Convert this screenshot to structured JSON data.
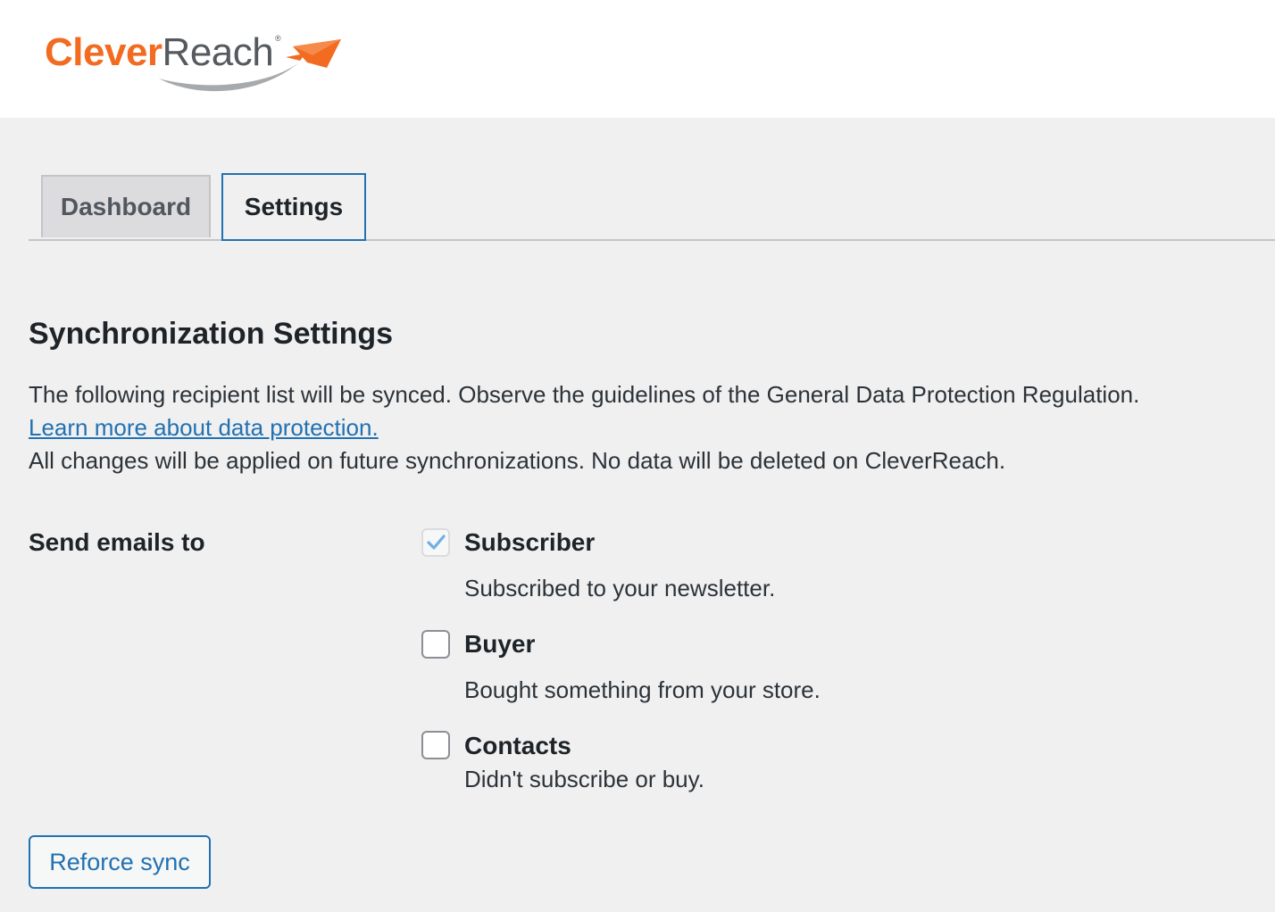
{
  "header": {
    "logo": {
      "brand_part1": "Clever",
      "brand_part2": "Reach",
      "registered_mark": "®",
      "icon": "envelope-swoosh-icon",
      "brand_color": "#f26b21"
    }
  },
  "tabs": [
    {
      "label": "Dashboard",
      "active": false
    },
    {
      "label": "Settings",
      "active": true
    }
  ],
  "main": {
    "title": "Synchronization Settings",
    "description_line1": "The following recipient list will be synced. Observe the guidelines of the General Data Protection Regulation.",
    "learn_more_link": "Learn more about data protection.",
    "description_line2": "All changes will be applied on future synchronizations. No data will be deleted on CleverReach.",
    "send_emails_label": "Send emails to",
    "options": [
      {
        "title": "Subscriber",
        "description": "Subscribed to your newsletter.",
        "checked": true,
        "disabled": true
      },
      {
        "title": "Buyer",
        "description": "Bought something from your store.",
        "checked": false,
        "disabled": false
      },
      {
        "title": "Contacts",
        "description": "Didn't subscribe or buy.",
        "checked": false,
        "disabled": false
      }
    ],
    "reforce_button": "Reforce sync"
  },
  "colors": {
    "accent": "#2271b1",
    "background": "#f0f0f1",
    "checkmark": "#72aee6"
  }
}
